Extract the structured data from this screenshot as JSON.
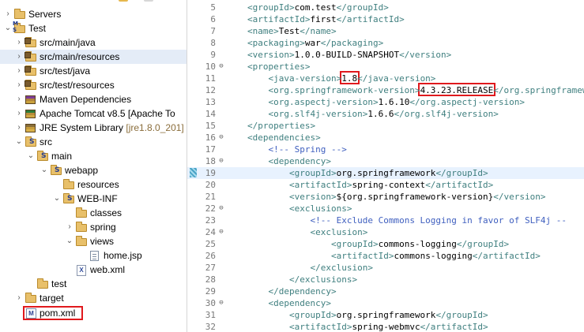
{
  "explorer": {
    "items": [
      {
        "id": "servers",
        "twisty": "›",
        "icon": "folder",
        "label": "Servers",
        "decoration": ""
      },
      {
        "id": "test-project",
        "twisty": "⌄",
        "icon": "maven-project",
        "label": "Test",
        "decoration": ""
      },
      {
        "id": "src-main-java",
        "twisty": "›",
        "icon": "package-folder",
        "label": "src/main/java",
        "decoration": ""
      },
      {
        "id": "src-main-resources",
        "twisty": "›",
        "icon": "package-folder",
        "label": "src/main/resources",
        "decoration": ""
      },
      {
        "id": "src-test-java",
        "twisty": "›",
        "icon": "package-folder",
        "label": "src/test/java",
        "decoration": ""
      },
      {
        "id": "src-test-resources",
        "twisty": "›",
        "icon": "package-folder",
        "label": "src/test/resources",
        "decoration": ""
      },
      {
        "id": "maven-dependencies",
        "twisty": "›",
        "icon": "maven-library",
        "label": "Maven Dependencies",
        "decoration": ""
      },
      {
        "id": "apache-tomcat",
        "twisty": "›",
        "icon": "tomcat-library",
        "label": "Apache Tomcat v8.5 [Apache To",
        "decoration": ""
      },
      {
        "id": "jre-library",
        "twisty": "›",
        "icon": "library",
        "label": "JRE System Library ",
        "decoration": "[jre1.8.0_201]"
      },
      {
        "id": "src",
        "twisty": "⌄",
        "icon": "spring-folder",
        "label": "src",
        "decoration": ""
      },
      {
        "id": "main",
        "twisty": "⌄",
        "icon": "spring-folder",
        "label": "main",
        "decoration": ""
      },
      {
        "id": "webapp",
        "twisty": "⌄",
        "icon": "spring-folder",
        "label": "webapp",
        "decoration": ""
      },
      {
        "id": "resources",
        "twisty": "",
        "icon": "folder",
        "label": "resources",
        "decoration": ""
      },
      {
        "id": "web-inf",
        "twisty": "⌄",
        "icon": "spring-folder",
        "label": "WEB-INF",
        "decoration": ""
      },
      {
        "id": "classes",
        "twisty": "",
        "icon": "folder",
        "label": "classes",
        "decoration": ""
      },
      {
        "id": "spring",
        "twisty": "›",
        "icon": "folder",
        "label": "spring",
        "decoration": ""
      },
      {
        "id": "views",
        "twisty": "⌄",
        "icon": "folder",
        "label": "views",
        "decoration": ""
      },
      {
        "id": "home-jsp",
        "twisty": "",
        "icon": "file",
        "label": "home.jsp",
        "decoration": ""
      },
      {
        "id": "web-xml",
        "twisty": "",
        "icon": "xml-file",
        "label": "web.xml",
        "decoration": ""
      },
      {
        "id": "test",
        "twisty": "",
        "icon": "folder",
        "label": "test",
        "decoration": ""
      },
      {
        "id": "target",
        "twisty": "›",
        "icon": "folder",
        "label": "target",
        "decoration": ""
      },
      {
        "id": "pom-xml",
        "twisty": "",
        "icon": "maven-file",
        "label": "pom.xml",
        "decoration": ""
      }
    ]
  },
  "editor": {
    "lines": [
      {
        "n": "5",
        "fold": "",
        "segments": [
          {
            "t": "tag",
            "v": "<groupId>"
          },
          {
            "t": "txt",
            "v": "com.test"
          },
          {
            "t": "tag",
            "v": "</groupId>"
          }
        ]
      },
      {
        "n": "6",
        "fold": "",
        "segments": [
          {
            "t": "tag",
            "v": "<artifactId>"
          },
          {
            "t": "txt",
            "v": "first"
          },
          {
            "t": "tag",
            "v": "</artifactId>"
          }
        ]
      },
      {
        "n": "7",
        "fold": "",
        "segments": [
          {
            "t": "tag",
            "v": "<name>"
          },
          {
            "t": "txt",
            "v": "Test"
          },
          {
            "t": "tag",
            "v": "</name>"
          }
        ]
      },
      {
        "n": "8",
        "fold": "",
        "segments": [
          {
            "t": "tag",
            "v": "<packaging>"
          },
          {
            "t": "txt",
            "v": "war"
          },
          {
            "t": "tag",
            "v": "</packaging>"
          }
        ]
      },
      {
        "n": "9",
        "fold": "",
        "segments": [
          {
            "t": "tag",
            "v": "<version>"
          },
          {
            "t": "txt",
            "v": "1.0.0-BUILD-SNAPSHOT"
          },
          {
            "t": "tag",
            "v": "</version>"
          }
        ]
      },
      {
        "n": "10",
        "fold": "⊖",
        "segments": [
          {
            "t": "tag",
            "v": "<properties>"
          }
        ]
      },
      {
        "n": "11",
        "fold": "",
        "segments": [
          {
            "t": "txt",
            "v": "    "
          },
          {
            "t": "tag",
            "v": "<java-version>"
          },
          {
            "t": "hl",
            "v": "1.8"
          },
          {
            "t": "tag",
            "v": "</java-version>"
          }
        ]
      },
      {
        "n": "12",
        "fold": "",
        "segments": [
          {
            "t": "txt",
            "v": "    "
          },
          {
            "t": "tag",
            "v": "<org.springframework-version>"
          },
          {
            "t": "hl",
            "v": "4.3.23.RELEASE"
          },
          {
            "t": "tag",
            "v": "</org.springframework-version>"
          }
        ]
      },
      {
        "n": "13",
        "fold": "",
        "segments": [
          {
            "t": "txt",
            "v": "    "
          },
          {
            "t": "tag",
            "v": "<org.aspectj-version>"
          },
          {
            "t": "txt",
            "v": "1.6.10"
          },
          {
            "t": "tag",
            "v": "</org.aspectj-version>"
          }
        ]
      },
      {
        "n": "14",
        "fold": "",
        "segments": [
          {
            "t": "txt",
            "v": "    "
          },
          {
            "t": "tag",
            "v": "<org.slf4j-version>"
          },
          {
            "t": "txt",
            "v": "1.6.6"
          },
          {
            "t": "tag",
            "v": "</org.slf4j-version>"
          }
        ]
      },
      {
        "n": "15",
        "fold": "",
        "segments": [
          {
            "t": "tag",
            "v": "</properties>"
          }
        ]
      },
      {
        "n": "16",
        "fold": "⊖",
        "segments": [
          {
            "t": "tag",
            "v": "<dependencies>"
          }
        ]
      },
      {
        "n": "17",
        "fold": "",
        "segments": [
          {
            "t": "txt",
            "v": "    "
          },
          {
            "t": "cmt",
            "v": "<!-- Spring -->"
          }
        ]
      },
      {
        "n": "18",
        "fold": "⊖",
        "segments": [
          {
            "t": "txt",
            "v": "    "
          },
          {
            "t": "tag",
            "v": "<dependency>"
          }
        ]
      },
      {
        "n": "19",
        "fold": "",
        "current": true,
        "segments": [
          {
            "t": "txt",
            "v": "        "
          },
          {
            "t": "tag",
            "v": "<groupId>"
          },
          {
            "t": "txt",
            "v": "org.springframework"
          },
          {
            "t": "tag",
            "v": "</groupId>"
          }
        ]
      },
      {
        "n": "20",
        "fold": "",
        "segments": [
          {
            "t": "txt",
            "v": "        "
          },
          {
            "t": "tag",
            "v": "<artifactId>"
          },
          {
            "t": "txt",
            "v": "spring-context"
          },
          {
            "t": "tag",
            "v": "</artifactId>"
          }
        ]
      },
      {
        "n": "21",
        "fold": "",
        "segments": [
          {
            "t": "txt",
            "v": "        "
          },
          {
            "t": "tag",
            "v": "<version>"
          },
          {
            "t": "txt",
            "v": "${org.springframework-version}"
          },
          {
            "t": "tag",
            "v": "</version>"
          }
        ]
      },
      {
        "n": "22",
        "fold": "⊖",
        "segments": [
          {
            "t": "txt",
            "v": "        "
          },
          {
            "t": "tag",
            "v": "<exclusions>"
          }
        ]
      },
      {
        "n": "23",
        "fold": "",
        "segments": [
          {
            "t": "txt",
            "v": "            "
          },
          {
            "t": "cmt",
            "v": "<!-- Exclude Commons Logging in favor of SLF4j --"
          }
        ]
      },
      {
        "n": "24",
        "fold": "⊖",
        "segments": [
          {
            "t": "txt",
            "v": "            "
          },
          {
            "t": "tag",
            "v": "<exclusion>"
          }
        ]
      },
      {
        "n": "25",
        "fold": "",
        "segments": [
          {
            "t": "txt",
            "v": "                "
          },
          {
            "t": "tag",
            "v": "<groupId>"
          },
          {
            "t": "txt",
            "v": "commons-logging"
          },
          {
            "t": "tag",
            "v": "</groupId>"
          }
        ]
      },
      {
        "n": "26",
        "fold": "",
        "segments": [
          {
            "t": "txt",
            "v": "                "
          },
          {
            "t": "tag",
            "v": "<artifactId>"
          },
          {
            "t": "txt",
            "v": "commons-logging"
          },
          {
            "t": "tag",
            "v": "</artifactId>"
          }
        ]
      },
      {
        "n": "27",
        "fold": "",
        "segments": [
          {
            "t": "txt",
            "v": "            "
          },
          {
            "t": "tag",
            "v": "</exclusion>"
          }
        ]
      },
      {
        "n": "28",
        "fold": "",
        "segments": [
          {
            "t": "txt",
            "v": "        "
          },
          {
            "t": "tag",
            "v": "</exclusions>"
          }
        ]
      },
      {
        "n": "29",
        "fold": "",
        "segments": [
          {
            "t": "txt",
            "v": "    "
          },
          {
            "t": "tag",
            "v": "</dependency>"
          }
        ]
      },
      {
        "n": "30",
        "fold": "⊖",
        "segments": [
          {
            "t": "txt",
            "v": "    "
          },
          {
            "t": "tag",
            "v": "<dependency>"
          }
        ]
      },
      {
        "n": "31",
        "fold": "",
        "segments": [
          {
            "t": "txt",
            "v": "        "
          },
          {
            "t": "tag",
            "v": "<groupId>"
          },
          {
            "t": "txt",
            "v": "org.springframework"
          },
          {
            "t": "tag",
            "v": "</groupId>"
          }
        ]
      },
      {
        "n": "32",
        "fold": "",
        "segments": [
          {
            "t": "txt",
            "v": "        "
          },
          {
            "t": "tag",
            "v": "<artifactId>"
          },
          {
            "t": "txt",
            "v": "spring-webmvc"
          },
          {
            "t": "tag",
            "v": "</artifactId>"
          }
        ]
      }
    ]
  },
  "colors": {
    "tag": "#3f7f7f",
    "comment": "#3f5fbf",
    "highlight_box": "#e0191d",
    "selection": "#e4ecf7",
    "current_line": "#e8f2fe"
  }
}
